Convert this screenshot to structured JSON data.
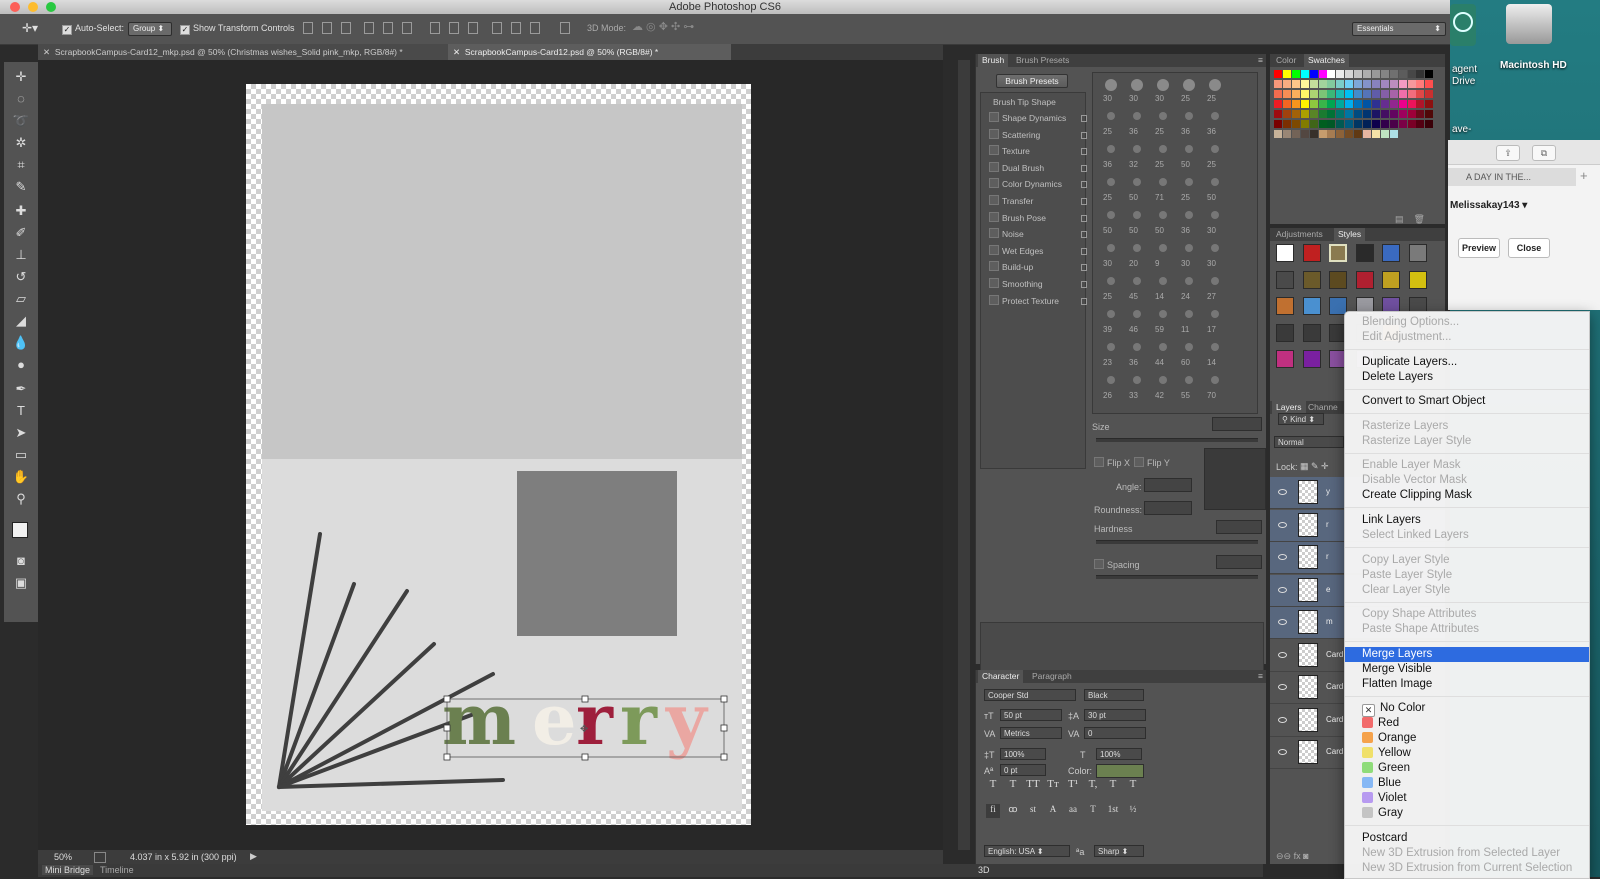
{
  "app": {
    "title": "Adobe Photoshop CS6"
  },
  "options_bar": {
    "auto_select_label": "Auto-Select:",
    "auto_select_value": "Group",
    "show_transform_label": "Show Transform Controls",
    "mode_3d_label": "3D Mode:",
    "workspace": "Essentials"
  },
  "doc_tabs": [
    {
      "label": "ScrapbookCampus-Card12_mkp.psd @ 50% (Christmas wishes_Solid pink_mkp, RGB/8#) *"
    },
    {
      "label": "ScrapbookCampus-Card12.psd @ 50% (RGB/8#) *"
    }
  ],
  "canvas": {
    "text_letters": [
      {
        "char": "m",
        "color": "#6b8050"
      },
      {
        "char": "e",
        "color": "#f2eee6"
      },
      {
        "char": "r",
        "color": "#9e1f3c"
      },
      {
        "char": "r",
        "color": "#7d9a5a"
      },
      {
        "char": "y",
        "color": "#eaa7a2"
      }
    ]
  },
  "status": {
    "zoom": "50%",
    "doc_info": "4.037 in x 5.92 in (300 ppi)"
  },
  "bottom_tabs": [
    "Mini Bridge",
    "Timeline"
  ],
  "brush_panel": {
    "tabs": [
      "Brush",
      "Brush Presets"
    ],
    "presets_button": "Brush Presets",
    "tip_shape_header": "Brush Tip Shape",
    "options": [
      "Shape Dynamics",
      "Scattering",
      "Texture",
      "Dual Brush",
      "Color Dynamics",
      "Transfer",
      "Brush Pose",
      "Noise",
      "Wet Edges",
      "Build-up",
      "Smoothing",
      "Protect Texture"
    ],
    "size_label": "Size",
    "flip_x": "Flip X",
    "flip_y": "Flip Y",
    "angle_label": "Angle:",
    "roundness_label": "Roundness:",
    "hardness_label": "Hardness",
    "spacing_label": "Spacing",
    "preset_sizes": [
      "30",
      "30",
      "30",
      "25",
      "25",
      "25",
      "36",
      "25",
      "36",
      "36",
      "36",
      "32",
      "25",
      "50",
      "25",
      "25",
      "50",
      "71",
      "25",
      "50",
      "50",
      "50",
      "50",
      "36",
      "30",
      "30",
      "20",
      "9",
      "30",
      "30",
      "25",
      "45",
      "14",
      "24",
      "27",
      "39",
      "46",
      "59",
      "11",
      "17",
      "23",
      "36",
      "44",
      "60",
      "14",
      "26",
      "33",
      "42",
      "55",
      "70"
    ]
  },
  "character_panel": {
    "tabs": [
      "Character",
      "Paragraph"
    ],
    "font_family": "Cooper Std",
    "font_style": "Black",
    "size": "50 pt",
    "leading": "30 pt",
    "kerning": "Metrics",
    "tracking": "0",
    "vscale": "100%",
    "hscale": "100%",
    "baseline": "0 pt",
    "color_label": "Color:",
    "color_value": "#6b8050",
    "type_styles": [
      "T",
      "T",
      "TT",
      "Tт",
      "T¹",
      "T,",
      "T",
      "T"
    ],
    "ot_styles": [
      "fi",
      "ꝏ",
      "st",
      "A",
      "aa",
      "T",
      "1st",
      "½"
    ],
    "language": "English: USA",
    "aa_label": "ªa",
    "antialias": "Sharp"
  },
  "color_panel": {
    "tabs": [
      "Color",
      "Swatches"
    ]
  },
  "styles_panel": {
    "tabs": [
      "Adjustments",
      "Styles"
    ]
  },
  "layers_panel": {
    "tabs": [
      "Layers",
      "Channe"
    ],
    "kind": "Kind",
    "blend_mode": "Normal",
    "lock_label": "Lock:",
    "layers": [
      "y",
      "r",
      "r",
      "e",
      "m",
      "Card",
      "Card",
      "Card",
      "Card"
    ]
  },
  "desktop": {
    "drive_label": "Macintosh HD",
    "agent_label1": "agent",
    "agent_label2": "Drive",
    "partial_label": "ave-",
    "safari_title": "A DAY IN THE...",
    "safari_user": "Melissakay143",
    "preview_btn": "Preview",
    "close_btn": "Close"
  },
  "context_menu": {
    "items": [
      {
        "label": "Blending Options...",
        "disabled": true
      },
      {
        "label": "Edit Adjustment...",
        "disabled": true
      },
      {
        "sep": true
      },
      {
        "label": "Duplicate Layers...",
        "disabled": false
      },
      {
        "label": "Delete Layers",
        "disabled": false
      },
      {
        "sep": true
      },
      {
        "label": "Convert to Smart Object",
        "disabled": false
      },
      {
        "sep": true
      },
      {
        "label": "Rasterize Layers",
        "disabled": true
      },
      {
        "label": "Rasterize Layer Style",
        "disabled": true
      },
      {
        "sep": true
      },
      {
        "label": "Enable Layer Mask",
        "disabled": true
      },
      {
        "label": "Disable Vector Mask",
        "disabled": true
      },
      {
        "label": "Create Clipping Mask",
        "disabled": false
      },
      {
        "sep": true
      },
      {
        "label": "Link Layers",
        "disabled": false
      },
      {
        "label": "Select Linked Layers",
        "disabled": true
      },
      {
        "sep": true
      },
      {
        "label": "Copy Layer Style",
        "disabled": true
      },
      {
        "label": "Paste Layer Style",
        "disabled": true
      },
      {
        "label": "Clear Layer Style",
        "disabled": true
      },
      {
        "sep": true
      },
      {
        "label": "Copy Shape Attributes",
        "disabled": true
      },
      {
        "label": "Paste Shape Attributes",
        "disabled": true
      },
      {
        "sep": true
      },
      {
        "label": "Merge Layers",
        "disabled": false,
        "highlighted": true
      },
      {
        "label": "Merge Visible",
        "disabled": false
      },
      {
        "label": "Flatten Image",
        "disabled": false
      },
      {
        "sep": true
      },
      {
        "label": "No Color",
        "color": "#ffffff",
        "checked": true
      },
      {
        "label": "Red",
        "color": "#f26b6b"
      },
      {
        "label": "Orange",
        "color": "#f5a24b"
      },
      {
        "label": "Yellow",
        "color": "#f0e06a"
      },
      {
        "label": "Green",
        "color": "#8fdc7a"
      },
      {
        "label": "Blue",
        "color": "#86b8f5"
      },
      {
        "label": "Violet",
        "color": "#b79af0"
      },
      {
        "label": "Gray",
        "color": "#c4c4c4"
      },
      {
        "sep": true
      },
      {
        "label": "Postcard",
        "disabled": false
      },
      {
        "label": "New 3D Extrusion from Selected Layer",
        "disabled": true
      },
      {
        "label": "New 3D Extrusion from Current Selection",
        "disabled": true
      }
    ]
  }
}
